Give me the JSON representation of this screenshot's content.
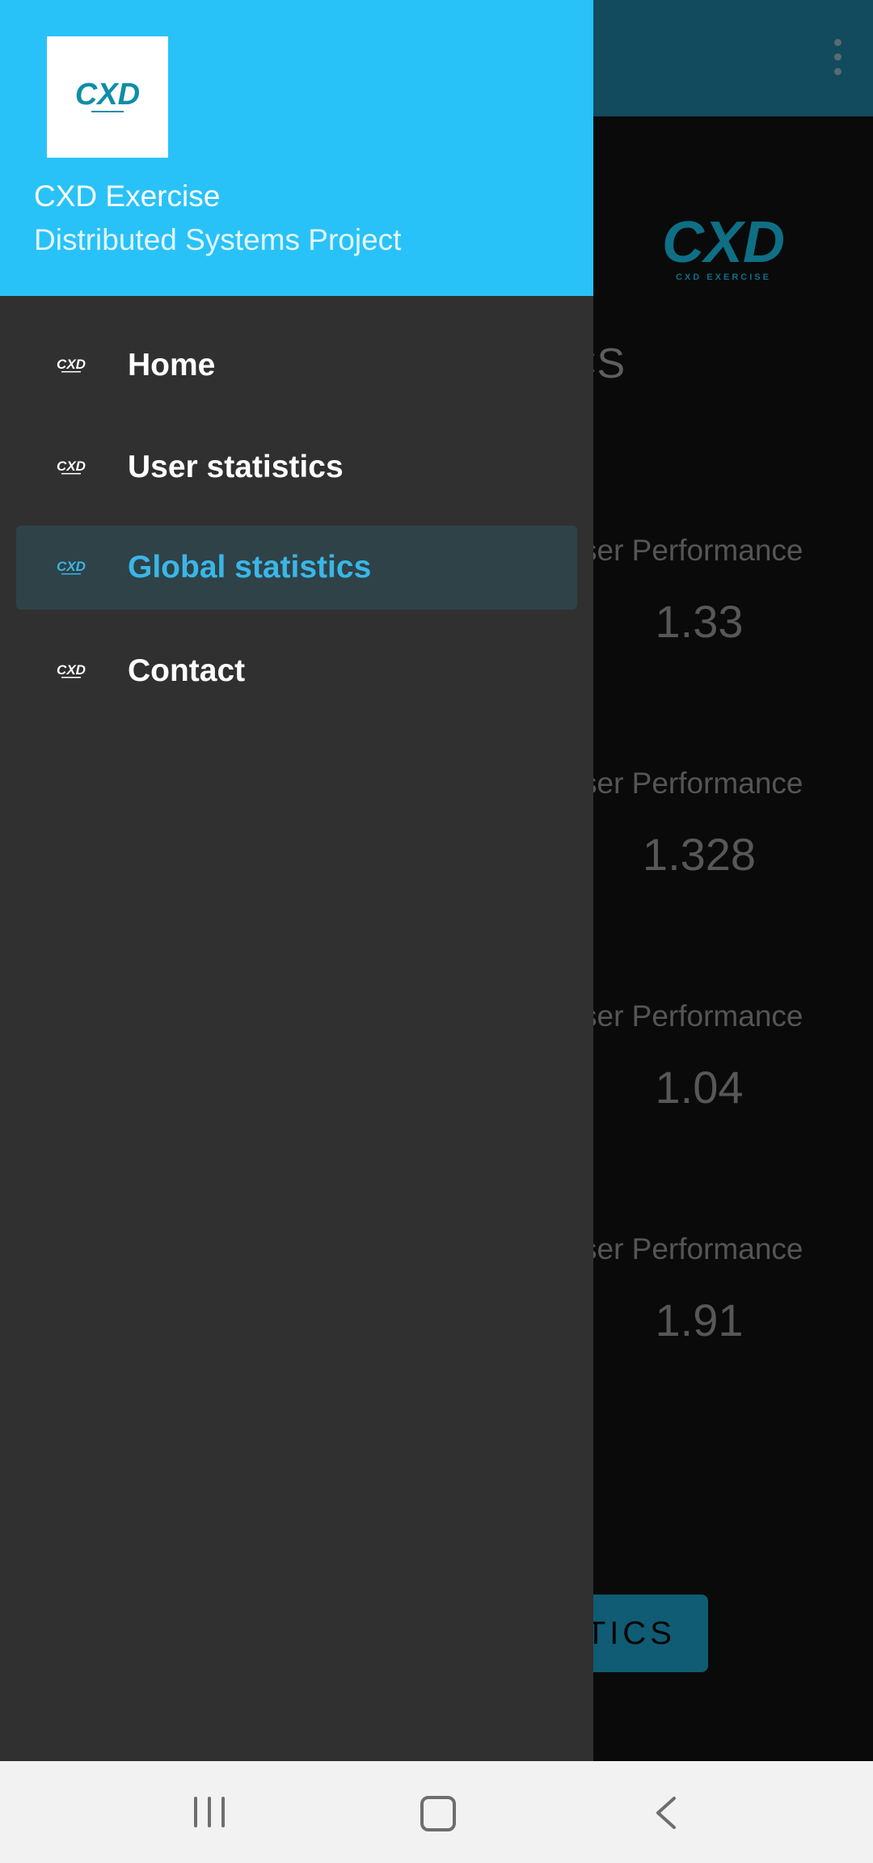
{
  "drawer": {
    "header": {
      "title": "CXD Exercise",
      "subtitle": "Distributed Systems Project",
      "background_color": "#29c2f8"
    },
    "items": [
      {
        "label": "Home",
        "icon": "cxd-logo-icon",
        "selected": false
      },
      {
        "label": "User statistics",
        "icon": "cxd-logo-icon",
        "selected": false
      },
      {
        "label": "Global statistics",
        "icon": "cxd-logo-icon",
        "selected": true
      },
      {
        "label": "Contact",
        "icon": "cxd-logo-icon",
        "selected": false
      }
    ],
    "accent_color": "#3ab6e8"
  },
  "background_screen": {
    "title_partial": "CS",
    "stats": [
      {
        "label": "ser Performance",
        "value": "1.33"
      },
      {
        "label": "ser Performance",
        "value": "1.328"
      },
      {
        "label": "ser Performance",
        "value": "1.04"
      },
      {
        "label": "ser Performance",
        "value": "1.91"
      }
    ],
    "button_partial": "TICS",
    "toolbar_color": "#124a5e",
    "logo_caption": "CXD EXERCISE"
  },
  "system_nav": {
    "buttons": [
      "recent-apps",
      "home",
      "back"
    ]
  }
}
